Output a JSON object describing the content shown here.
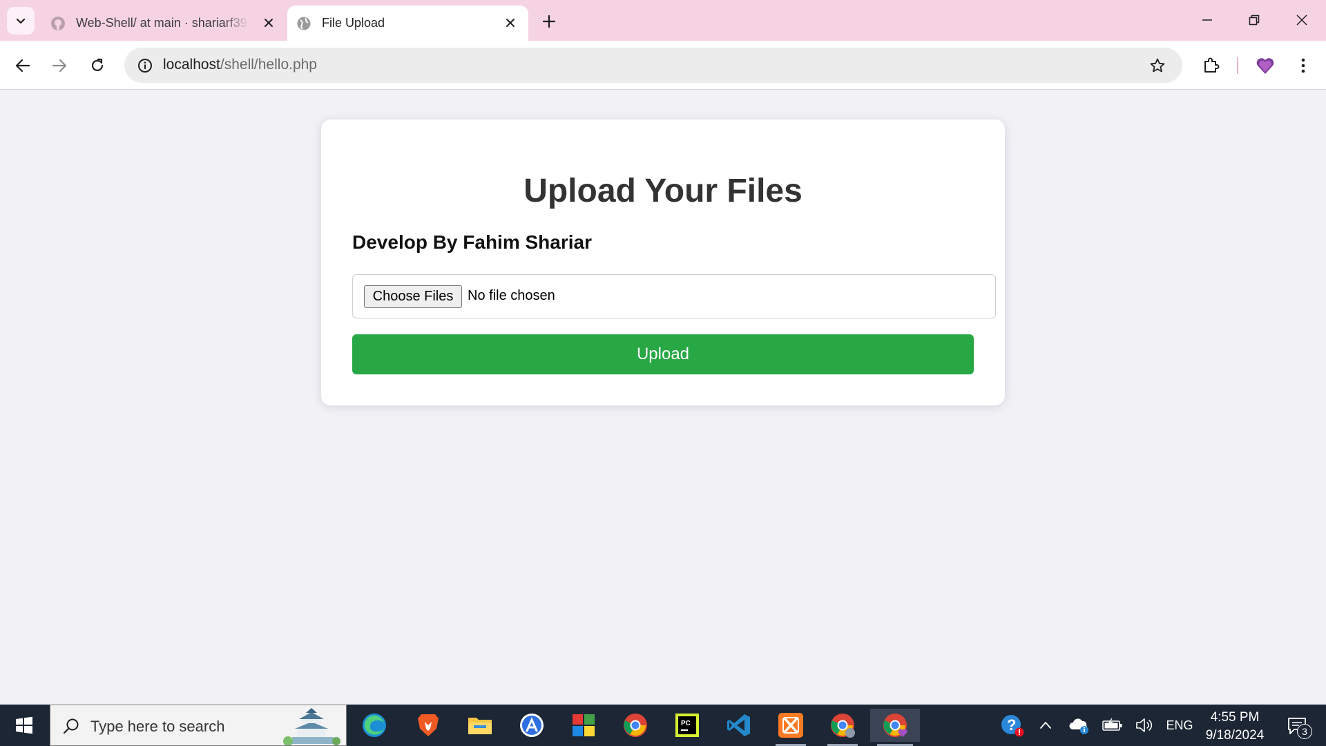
{
  "browser": {
    "tabs": [
      {
        "title": "Web-Shell/ at main · shariarf39/",
        "favicon": "github-icon",
        "active": false
      },
      {
        "title": "File Upload",
        "favicon": "globe-icon",
        "active": true
      }
    ],
    "address": {
      "host": "localhost",
      "path": "/shell/hello.php"
    },
    "accent_color": "#f5d3e3"
  },
  "page": {
    "title": "Upload Your Files",
    "subtitle": "Develop By Fahim Shariar",
    "file_input": {
      "button_label": "Choose Files",
      "status": "No file chosen"
    },
    "upload_button": "Upload",
    "upload_button_color": "#28a745"
  },
  "taskbar": {
    "search_placeholder": "Type here to search",
    "pinned_apps": [
      "edge-icon",
      "brave-icon",
      "file-explorer-icon",
      "app-store-icon",
      "office-icon",
      "chrome-icon",
      "pycharm-icon",
      "vscode-icon",
      "xampp-icon",
      "chrome-profile-icon",
      "chrome-active-icon"
    ],
    "tray": {
      "language": "ENG"
    },
    "clock": {
      "time": "4:55 PM",
      "date": "9/18/2024"
    },
    "notifications_count": "3"
  }
}
